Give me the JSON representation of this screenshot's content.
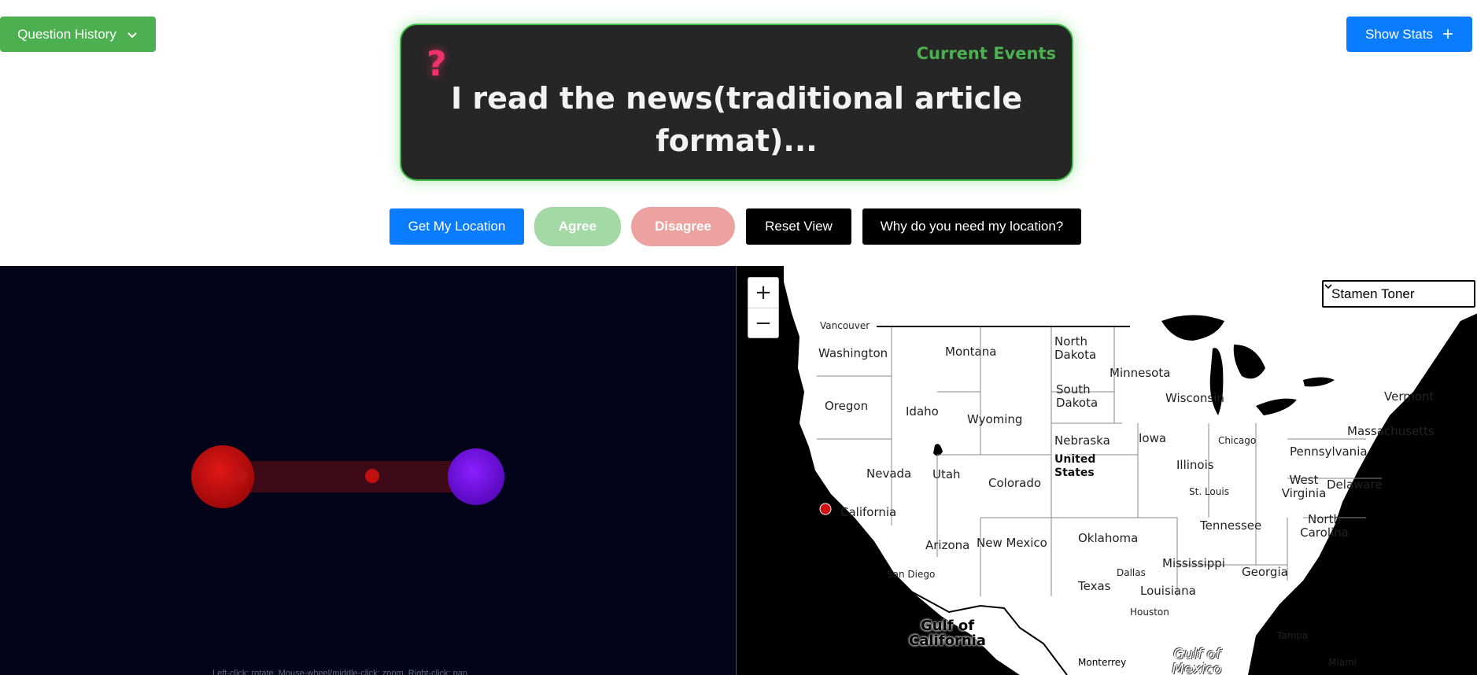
{
  "header": {
    "history_label": "Question History",
    "stats_label": "Show Stats",
    "stats_icon": "+"
  },
  "question_card": {
    "icon": "?",
    "category": "Current Events",
    "text": "I read the news(traditional article format)..."
  },
  "actions": {
    "location": "Get My Location",
    "agree": "Agree",
    "disagree": "Disagree",
    "reset": "Reset View",
    "why": "Why do you need my location?"
  },
  "visualization": {
    "hint": "Left-click: rotate, Mouse-wheel/middle-click: zoom, Right-click: pan"
  },
  "map": {
    "zoom_in": "+",
    "zoom_out": "−",
    "layer_selected": "Stamen Toner",
    "labels": {
      "vancouver": "Vancouver",
      "washington": "Washington",
      "montana": "Montana",
      "north_dakota": "North Dakota",
      "minnesota": "Minnesota",
      "oregon": "Oregon",
      "idaho": "Idaho",
      "wyoming": "Wyoming",
      "south_dakota": "South Dakota",
      "wisconsin": "Wisconsin",
      "vermont": "Vermont",
      "massachusetts": "Massachusetts",
      "chicago": "Chicago",
      "nebraska": "Nebraska",
      "iowa": "Iowa",
      "pennsylvania": "Pennsylvania",
      "nevada": "Nevada",
      "utah": "Utah",
      "united_states": "United States",
      "illinois": "Illinois",
      "colorado": "Colorado",
      "st_louis": "St. Louis",
      "west_virginia": "West Virginia",
      "delaware": "Delaware",
      "california": "California",
      "tennessee": "Tennessee",
      "north_carolina": "North Carolina",
      "arizona": "Arizona",
      "new_mexico": "New Mexico",
      "oklahoma": "Oklahoma",
      "mississippi": "Mississippi",
      "georgia": "Georgia",
      "san_diego": "San Diego",
      "dallas": "Dallas",
      "texas": "Texas",
      "louisiana": "Louisiana",
      "houston": "Houston",
      "gulf_california": "Gulf of California",
      "tampa": "Tampa",
      "gulf_mexico": "Gulf of Mexico",
      "monterrey": "Monterrey",
      "miami": "Miami"
    }
  },
  "colors": {
    "history_green": "#4caf50",
    "primary_blue": "#0a7cff",
    "card_bg": "#262626",
    "agree": "#a3d9a5",
    "disagree": "#eca3a0",
    "viz_bg": "#03031a",
    "marker_red": "#d01010",
    "marker_purple": "#7a10e8"
  }
}
